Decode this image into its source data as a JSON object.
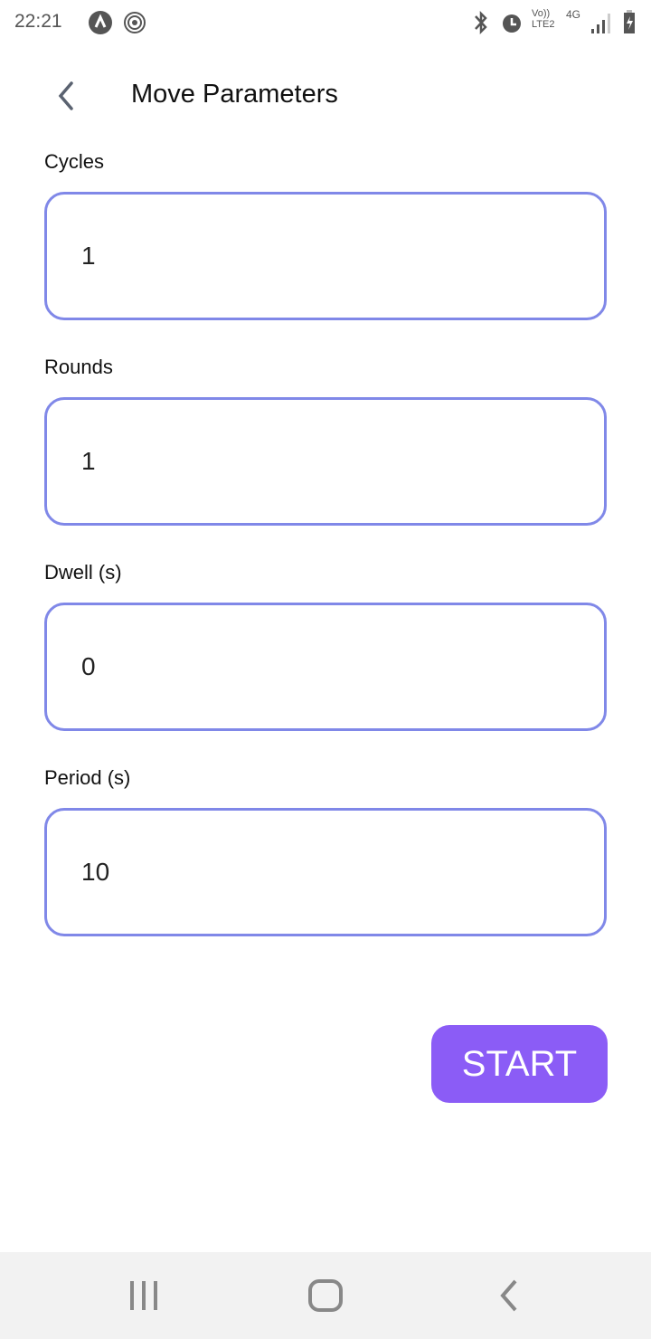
{
  "status_bar": {
    "time": "22:21",
    "icons": [
      "app-icon",
      "hotspot-icon",
      "bluetooth-icon",
      "alarm-icon",
      "volte-icon",
      "4g-icon",
      "signal-icon",
      "battery-charging-icon"
    ],
    "volte_text": "Vo)) LTE2",
    "network_text": "4G"
  },
  "header": {
    "title": "Move Parameters"
  },
  "fields": [
    {
      "label": "Cycles",
      "value": "1"
    },
    {
      "label": "Rounds",
      "value": "1"
    },
    {
      "label": "Dwell (s)",
      "value": "0"
    },
    {
      "label": "Period (s)",
      "value": "10"
    }
  ],
  "start_label": "START",
  "colors": {
    "accent": "#8B5CF6",
    "field_border": "#8088E8"
  }
}
